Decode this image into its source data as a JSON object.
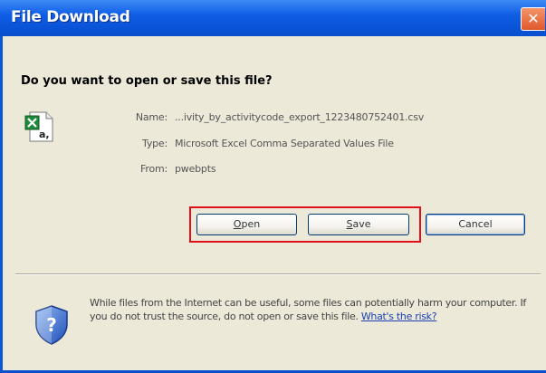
{
  "window": {
    "title": "File Download",
    "close_symbol": "✕"
  },
  "prompt": {
    "question": "Do you want to open or save this file?"
  },
  "file": {
    "icon": "excel-csv-file-icon",
    "name_label": "Name:",
    "name_value": "...ivity_by_activitycode_export_1223480752401.csv",
    "type_label": "Type:",
    "type_value": "Microsoft Excel Comma Separated Values File",
    "from_label": "From:",
    "from_value": "pwebpts"
  },
  "buttons": {
    "open": {
      "accel": "O",
      "rest": "pen"
    },
    "save": {
      "accel": "S",
      "rest": "ave"
    },
    "cancel": "Cancel"
  },
  "warning": {
    "icon": "security-shield-question-icon",
    "text": "While files from the Internet can be useful, some files can potentially harm your computer. If you do not trust the source, do not open or save this file.",
    "link": "What's the risk?"
  },
  "colors": {
    "titlebar": "#0a54d8",
    "dialog_bg": "#ece9d8",
    "highlight": "#e0101a",
    "link": "#1a3fb4"
  }
}
